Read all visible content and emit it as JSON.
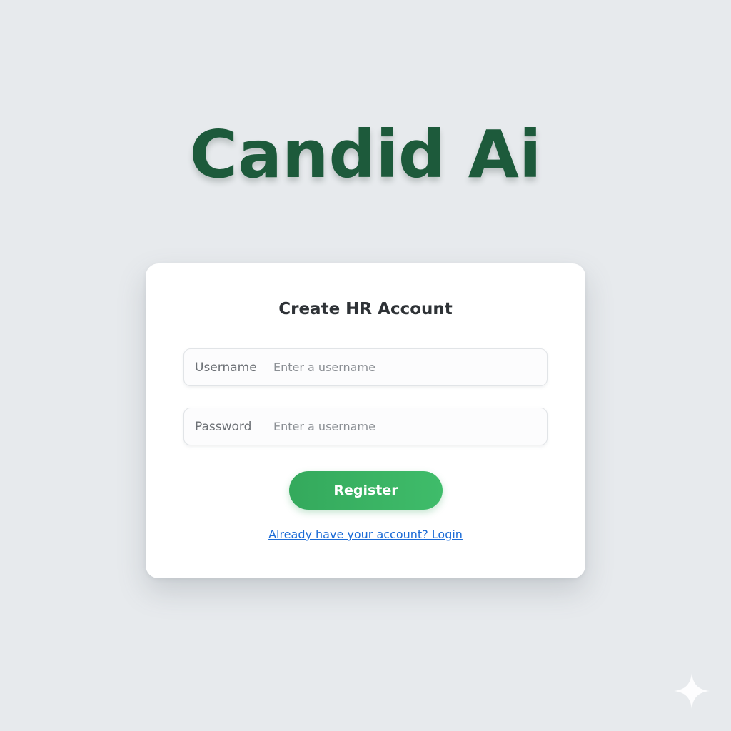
{
  "brand": {
    "title": "Candid Ai",
    "color": "#1d5a3b"
  },
  "form": {
    "title": "Create HR Account",
    "username": {
      "label": "Username",
      "placeholder": "Enter a username",
      "value": ""
    },
    "password": {
      "label": "Password",
      "placeholder": "Enter a username",
      "value": ""
    },
    "register_label": "Register",
    "login_link": "Already have your account? Login"
  },
  "colors": {
    "background": "#e7eaed",
    "button": "#3cb464",
    "link": "#1b6bd6"
  },
  "icons": {
    "corner": "sparkle-icon"
  }
}
